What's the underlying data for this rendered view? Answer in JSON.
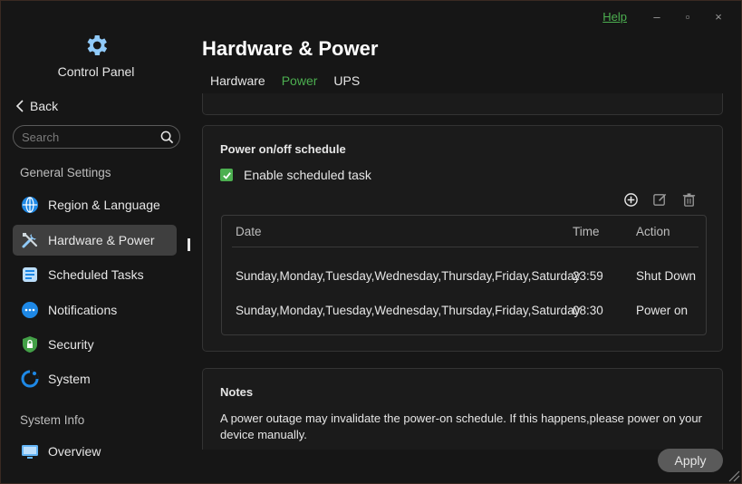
{
  "window": {
    "help_label": "Help",
    "minimize_glyph": "–",
    "maximize_glyph": "▫",
    "close_glyph": "×"
  },
  "sidebar": {
    "app_title": "Control Panel",
    "back_label": "Back",
    "search_placeholder": "Search",
    "sections": [
      {
        "label": "General Settings",
        "items": [
          {
            "label": "Region & Language",
            "icon": "globe-icon",
            "color": "#1e88e5"
          },
          {
            "label": "Hardware & Power",
            "icon": "tools-icon",
            "color": "#90caf9",
            "active": true
          },
          {
            "label": "Scheduled Tasks",
            "icon": "tasks-icon",
            "color": "#64b5f6"
          },
          {
            "label": "Notifications",
            "icon": "chat-bubble-icon",
            "color": "#1e88e5"
          },
          {
            "label": "Security",
            "icon": "shield-lock-icon",
            "color": "#43a047"
          },
          {
            "label": "System",
            "icon": "system-icon",
            "color": "#1e88e5"
          }
        ]
      },
      {
        "label": "System Info",
        "items": [
          {
            "label": "Overview",
            "icon": "monitor-icon",
            "color": "#64b5f6"
          }
        ]
      }
    ]
  },
  "main": {
    "title": "Hardware & Power",
    "tabs": [
      {
        "label": "Hardware",
        "active": false
      },
      {
        "label": "Power",
        "active": true
      },
      {
        "label": "UPS",
        "active": false
      }
    ],
    "schedule": {
      "title": "Power on/off schedule",
      "enable_label": "Enable scheduled task",
      "enable_checked": true,
      "columns": [
        "Date",
        "Time",
        "Action"
      ],
      "rows": [
        {
          "date": "Sunday,Monday,Tuesday,Wednesday,Thursday,Friday,Saturday",
          "time": "23:59",
          "action": "Shut Down"
        },
        {
          "date": "Sunday,Monday,Tuesday,Wednesday,Thursday,Friday,Saturday",
          "time": "08:30",
          "action": "Power on"
        }
      ]
    },
    "notes": {
      "title": "Notes",
      "text": "A power outage may invalidate the power-on schedule. If this happens,please power on your device manually."
    },
    "apply_label": "Apply"
  },
  "colors": {
    "accent": "#4caf50",
    "background": "#161616",
    "card": "#1b1b1b"
  }
}
